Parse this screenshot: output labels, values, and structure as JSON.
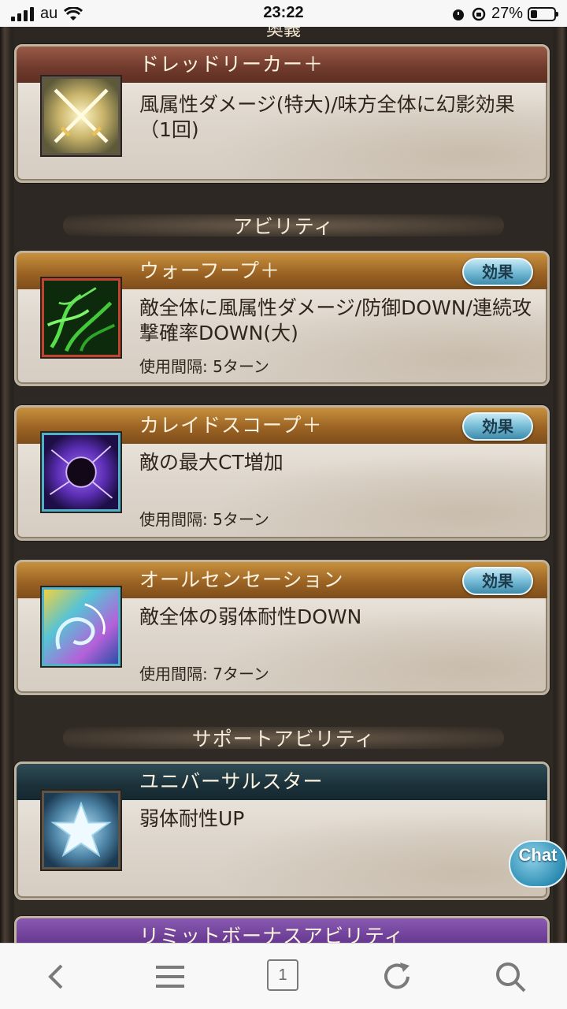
{
  "status_bar": {
    "carrier": "au",
    "time": "23:22",
    "battery": "27%",
    "battery_fraction": 0.27
  },
  "top_section_title_clipped": "奥義",
  "cards": [
    {
      "id": "dread-reaper",
      "header": "ドレッドリーカー＋",
      "header_style": "red",
      "description": "風属性ダメージ(特大)/味方全体に幻影効果（1回)",
      "interval": "",
      "has_effect_button": false,
      "icon": "crossed-swords-icon"
    },
    {
      "id": "war-hoop",
      "header": "ウォーフープ＋",
      "header_style": "orange",
      "description": "敵全体に風属性ダメージ/防御DOWN/連続攻撃確率DOWN(大)",
      "interval": "使用間隔: 5ターン",
      "has_effect_button": true,
      "icon": "green-tendrils-icon"
    },
    {
      "id": "kaleidoscope",
      "header": "カレイドスコープ＋",
      "header_style": "orange",
      "description": "敵の最大CT増加",
      "interval": "使用間隔: 5ターン",
      "has_effect_button": true,
      "icon": "dark-orb-icon"
    },
    {
      "id": "all-sensation",
      "header": "オールセンセーション",
      "header_style": "orange",
      "description": "敵全体の弱体耐性DOWN",
      "interval": "使用間隔: 7ターン",
      "has_effect_button": true,
      "icon": "swirl-icon"
    },
    {
      "id": "universal-star",
      "header": "ユニバーサルスター",
      "header_style": "teal",
      "description": "弱体耐性UP",
      "interval": "",
      "has_effect_button": false,
      "icon": "star-icon"
    }
  ],
  "effect_button_label": "効果",
  "sections": {
    "ability": "アビリティ",
    "support_ability": "サポートアビリティ",
    "limit_bonus": "リミットボーナスアビリティ"
  },
  "chat_label": "Chat",
  "browser": {
    "tab_count": "1"
  }
}
